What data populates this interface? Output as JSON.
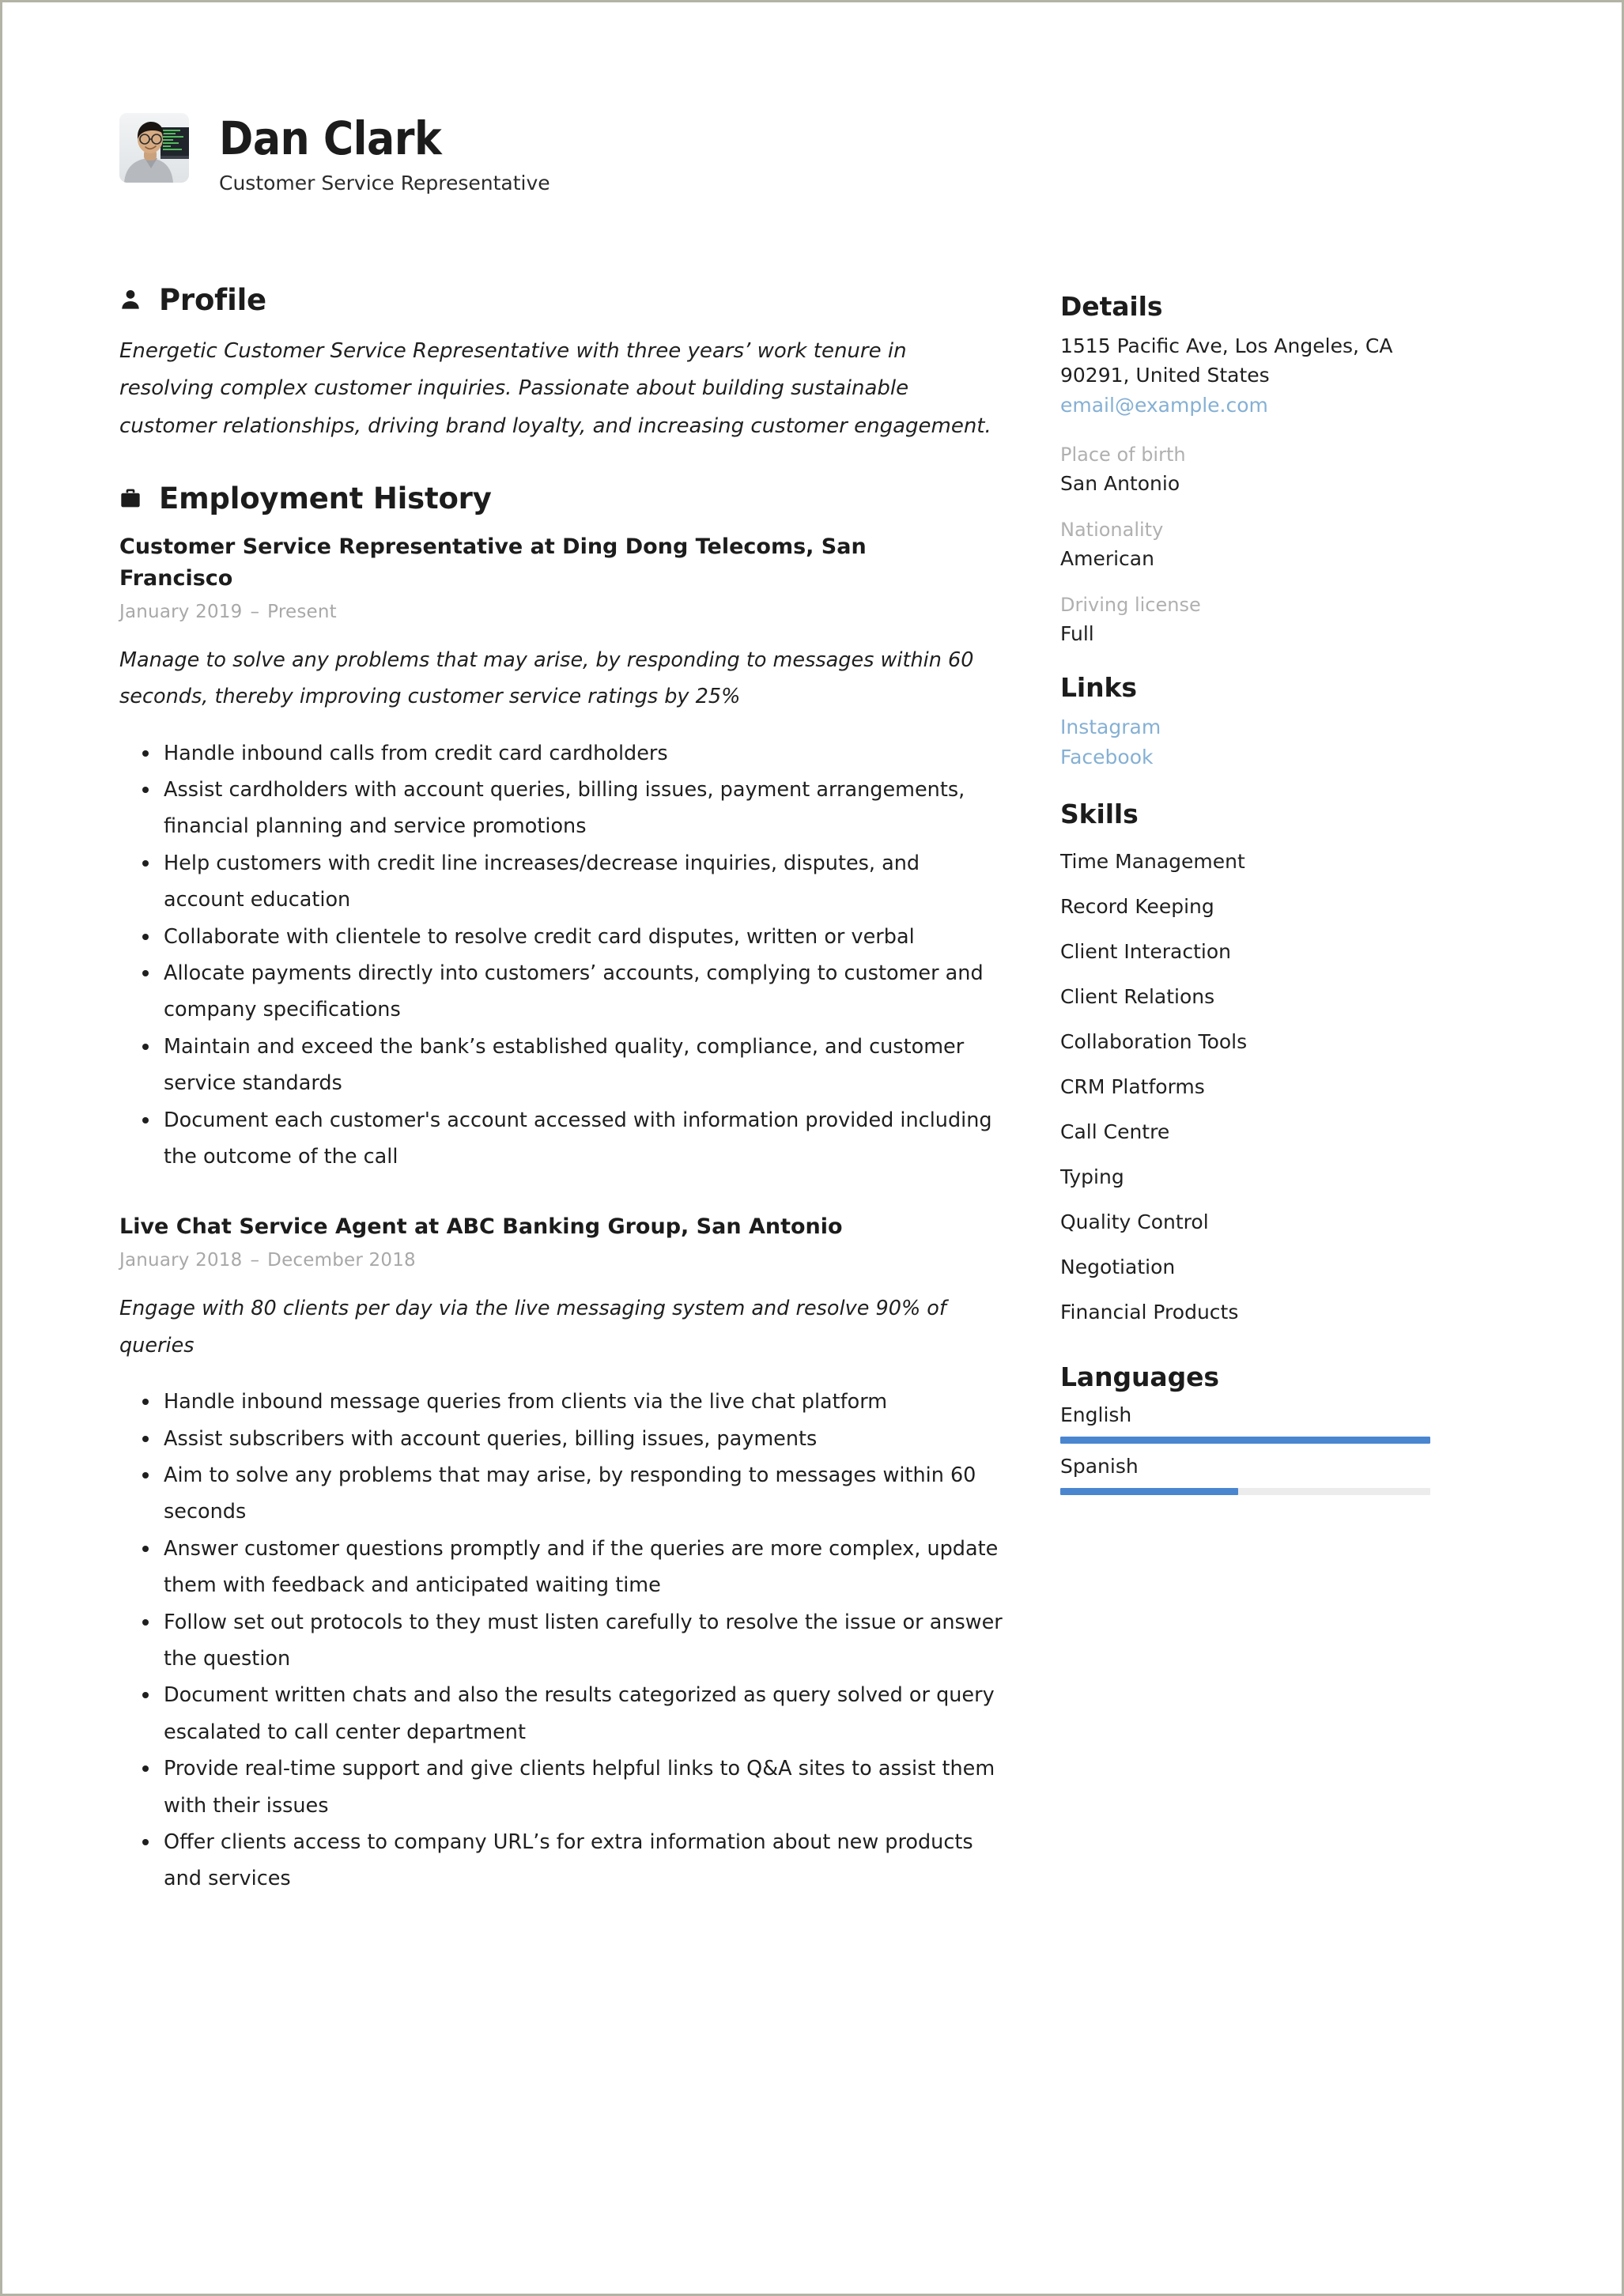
{
  "header": {
    "full_name": "Dan Clark",
    "job_title": "Customer Service Representative",
    "avatar_alt": "profile-photo"
  },
  "profile": {
    "heading": "Profile",
    "icon": "person-icon",
    "text": "Energetic Customer Service Representative with three years’ work tenure in resolving complex customer inquiries. Passionate about building sustainable customer relationships, driving brand loyalty, and increasing customer engagement."
  },
  "employment": {
    "heading": "Employment History",
    "icon": "briefcase-icon",
    "jobs": [
      {
        "title": "Customer Service Representative at Ding Dong Telecoms, San Francisco",
        "date_start": "January 2019",
        "date_sep": "–",
        "date_end": "Present",
        "summary": "Manage to solve any problems that may arise, by responding to messages within 60 seconds, thereby improving customer service ratings by 25%",
        "bullets": [
          "Handle inbound calls from credit card cardholders",
          "Assist cardholders with account queries, billing issues, payment arrangements, financial planning and service promotions",
          "Help customers with credit line increases/decrease inquiries, disputes, and account education",
          "Collaborate with clientele to resolve credit card disputes, written or verbal",
          "Allocate payments directly into customers’ accounts, complying to customer and company specifications",
          "Maintain and exceed the bank’s established quality, compliance, and customer service standards",
          "Document each customer's account accessed with information provided including the outcome of the call"
        ]
      },
      {
        "title": "Live Chat Service Agent at ABC Banking Group, San Antonio",
        "date_start": "January 2018",
        "date_sep": "–",
        "date_end": "December 2018",
        "summary": "Engage with 80 clients per day via the live messaging system and resolve 90% of queries",
        "bullets": [
          "Handle inbound message queries from clients via the live chat platform",
          "Assist subscribers with account queries, billing issues, payments",
          "Aim to solve any problems that may arise, by responding to messages within 60 seconds",
          "Answer customer questions promptly and if the queries are more complex, update them with feedback and anticipated waiting time",
          "Follow set out protocols to they must listen carefully to resolve the issue or answer the question",
          "Document written chats and also the results categorized as query solved or query escalated to call center department",
          "Provide real-time support and give clients helpful links to Q&A sites to assist them with their issues",
          "Offer clients access to company URL’s for extra information about new products and services"
        ]
      }
    ]
  },
  "details": {
    "heading": "Details",
    "address_line1": "1515 Pacific Ave, Los Angeles, CA",
    "address_line2": "90291, United States",
    "email": "email@example.com",
    "fields": [
      {
        "label": "Place of birth",
        "value": "San Antonio"
      },
      {
        "label": "Nationality",
        "value": "American"
      },
      {
        "label": "Driving license",
        "value": "Full"
      }
    ]
  },
  "links": {
    "heading": "Links",
    "items": [
      {
        "label": "Instagram"
      },
      {
        "label": "Facebook"
      }
    ]
  },
  "skills": {
    "heading": "Skills",
    "items": [
      "Time Management",
      "Record Keeping",
      "Client Interaction",
      "Client Relations",
      "Collaboration Tools",
      "CRM Platforms",
      "Call Centre",
      "Typing",
      "Quality Control",
      "Negotiation",
      "Financial Products"
    ]
  },
  "languages": {
    "heading": "Languages",
    "items": [
      {
        "name": "English",
        "level_percent": 100
      },
      {
        "name": "Spanish",
        "level_percent": 48
      }
    ]
  },
  "colors": {
    "link": "#85b0d4",
    "bar_fill": "#4a86d0",
    "bar_track": "#ececec",
    "muted_label": "#b0b0b0",
    "text": "#1f1f1f"
  }
}
